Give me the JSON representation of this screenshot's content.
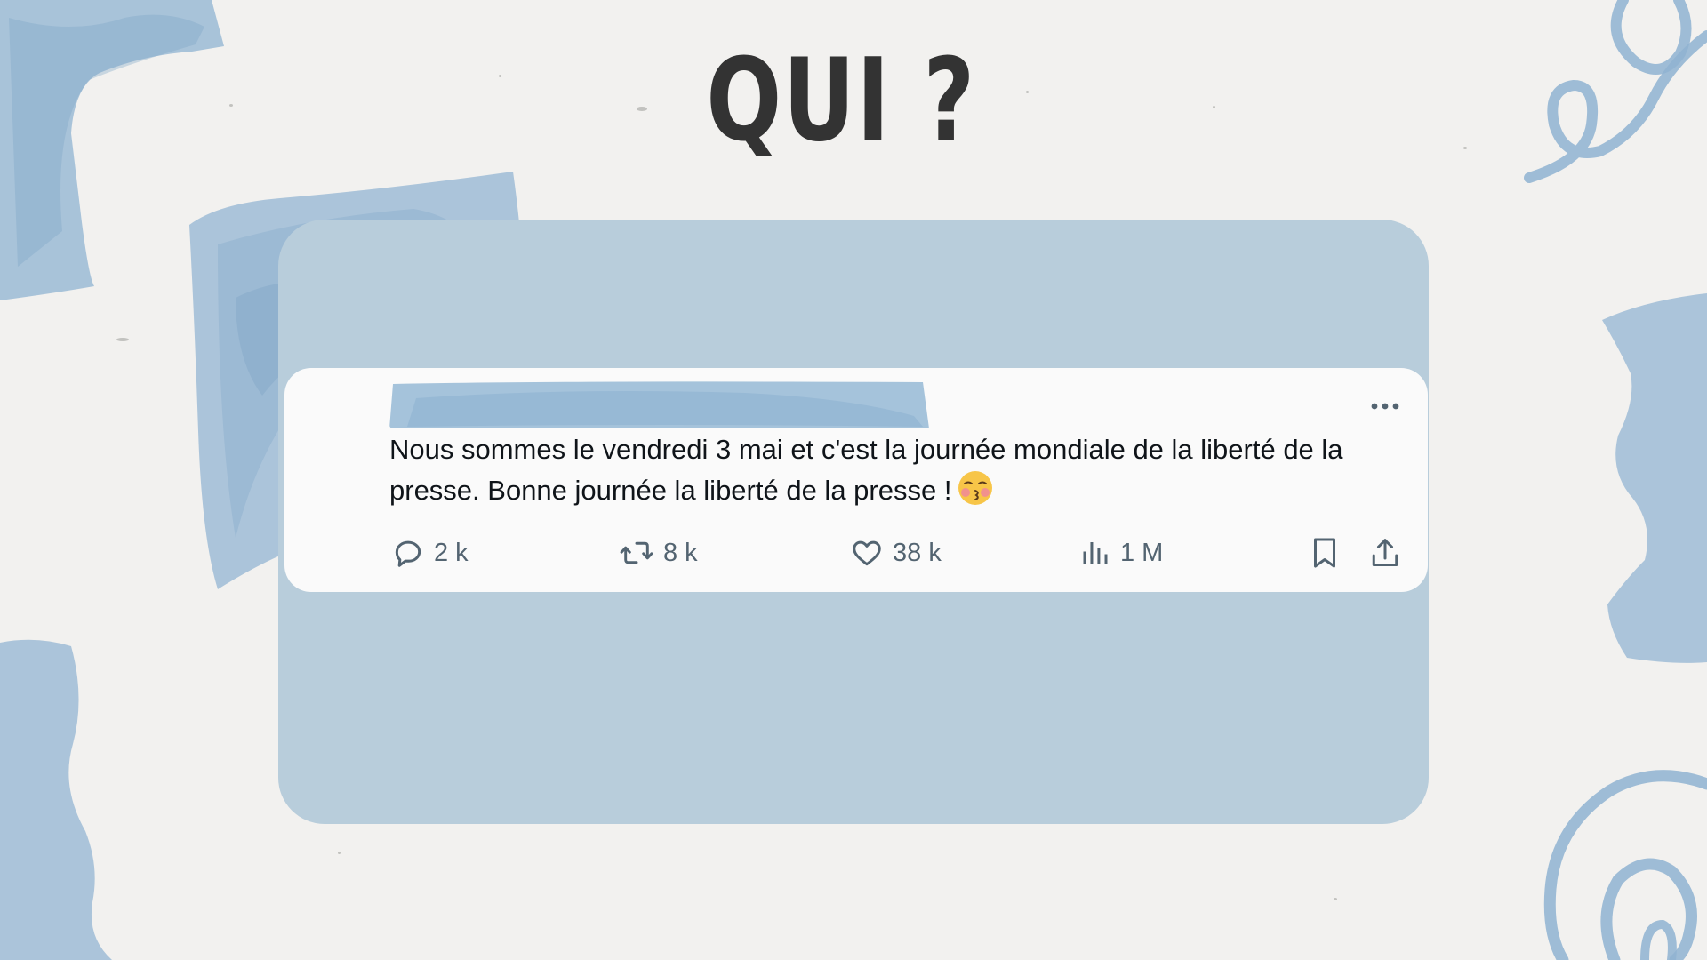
{
  "slide": {
    "title": "QUI ?"
  },
  "tweet": {
    "text": "Nous sommes le vendredi 3 mai et c'est la journée mondiale de la liberté de la presse. Bonne journée la liberté de la presse !",
    "emoji": "kissing-face-with-closed-eyes",
    "more_icon": "more-horizontal-icon",
    "actions": {
      "reply": {
        "icon": "reply-icon",
        "count": "2 k"
      },
      "retweet": {
        "icon": "retweet-icon",
        "count": "8 k"
      },
      "like": {
        "icon": "heart-icon",
        "count": "38 k"
      },
      "views": {
        "icon": "views-chart-icon",
        "count": "1 M"
      },
      "bookmark": {
        "icon": "bookmark-icon"
      },
      "share": {
        "icon": "share-icon"
      }
    }
  },
  "colors": {
    "background": "#f2f1ef",
    "card": "#b8cddb",
    "watercolor": "#8fb3d1",
    "title": "#333333",
    "tweet_text": "#0f1419",
    "action_icon": "#536471"
  }
}
